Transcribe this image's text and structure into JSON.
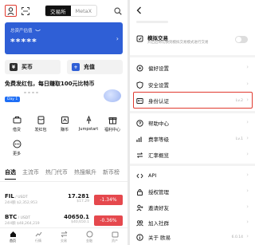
{
  "left": {
    "segment": [
      "交易所",
      "MetaX"
    ],
    "asset_card": {
      "label": "总资产估值",
      "value": "*****"
    },
    "actions": [
      {
        "label": "买币",
        "icon": "buy-icon",
        "color": "#2f2f2f"
      },
      {
        "label": "充值",
        "icon": "deposit-icon",
        "color": "#2f5fd6"
      }
    ],
    "banner": {
      "title": "免费发红包，每日赚取100元比特币",
      "badge": "Day 1"
    },
    "shortcuts": [
      {
        "label": "借贷",
        "icon": "loan-icon"
      },
      {
        "label": "发红包",
        "icon": "red-packet-icon"
      },
      {
        "label": "赚币",
        "icon": "earn-icon"
      },
      {
        "label": "Jumpstart",
        "icon": "jumpstart-icon"
      },
      {
        "label": "福利中心",
        "icon": "rewards-icon"
      },
      {
        "label": "更多",
        "icon": "more-icon"
      }
    ],
    "market_tabs": [
      "自选",
      "主流币",
      "热门代币",
      "热搜飙升",
      "新币榜"
    ],
    "rows": [
      {
        "symbol": "FIL",
        "quote": " / USDT",
        "volume": "24H额 $2,352,953",
        "price": "17.281",
        "fiat": "$17.29",
        "change": "-1.34%"
      },
      {
        "symbol": "BTC",
        "quote": " / USDT",
        "volume": "24H额 $48,264,219",
        "price": "40650.1",
        "fiat": "$40,650.1",
        "change": "-0.36%"
      }
    ],
    "bottom_nav": [
      {
        "label": "首页",
        "icon": "home-nav-icon"
      },
      {
        "label": "行情",
        "icon": "market-nav-icon"
      },
      {
        "label": "交易",
        "icon": "trade-nav-icon"
      },
      {
        "label": "金融",
        "icon": "finance-nav-icon"
      },
      {
        "label": "资产",
        "icon": "assets-nav-icon"
      }
    ]
  },
  "right": {
    "demo": {
      "title": "模拟交易",
      "subtitle": "开启后将切换到模拟交易模式进行交易"
    },
    "menu": [
      {
        "label": "偏好设置",
        "icon": "preferences-icon",
        "extra": ""
      },
      {
        "label": "安全设置",
        "icon": "security-icon",
        "extra": ""
      },
      {
        "label": "身份认证",
        "icon": "identity-icon",
        "extra": "Lv.2"
      },
      {
        "label": "帮助中心",
        "icon": "help-icon",
        "extra": ""
      },
      {
        "label": "费率等级",
        "icon": "fee-tier-icon",
        "extra": "Lv.1"
      },
      {
        "label": "汇率概览",
        "icon": "exchange-rate-icon",
        "extra": ""
      },
      {
        "label": "API",
        "icon": "api-icon",
        "extra": ""
      },
      {
        "label": "授权管理",
        "icon": "authorization-icon",
        "extra": ""
      },
      {
        "label": "邀请好友",
        "icon": "invite-icon",
        "extra": ""
      },
      {
        "label": "加入社群",
        "icon": "community-icon",
        "extra": ""
      },
      {
        "label": "关于 欧易",
        "icon": "about-icon",
        "extra": "6.0.14"
      }
    ]
  },
  "colors": {
    "accent_blue": "#2f5fd6",
    "highlight_red": "#e03a2f",
    "down_red": "#e5484d"
  }
}
